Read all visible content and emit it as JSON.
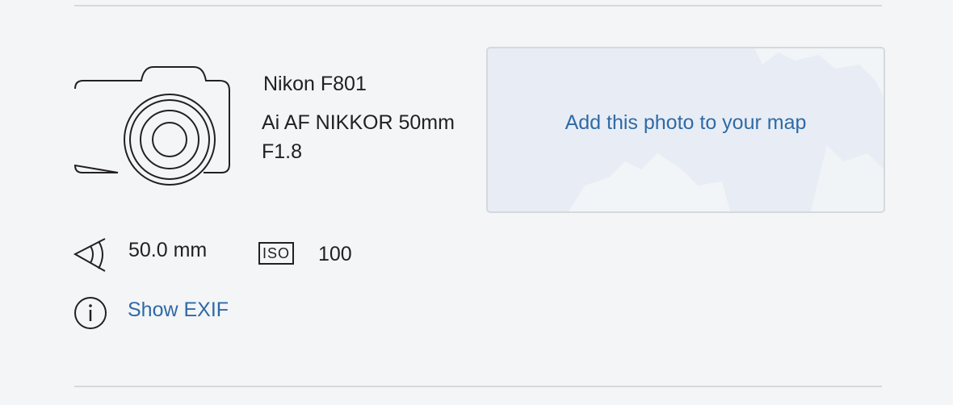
{
  "gear": {
    "camera": "Nikon F801",
    "lens": "Ai AF NIKKOR 50mm F1.8",
    "camera_icon": "camera-icon"
  },
  "map": {
    "link_text": "Add this photo to your map"
  },
  "exposure": {
    "focal_length": "50.0 mm",
    "focal_icon": "focal-length-eye-icon",
    "iso_badge": "ISO",
    "iso_value": "100"
  },
  "exif": {
    "link_text": "Show EXIF",
    "icon": "info-icon"
  },
  "colors": {
    "background": "#f3f5f7",
    "link": "#2f6aa6",
    "divider": "#d5d9dc",
    "map_fill": "#e8edf5"
  }
}
